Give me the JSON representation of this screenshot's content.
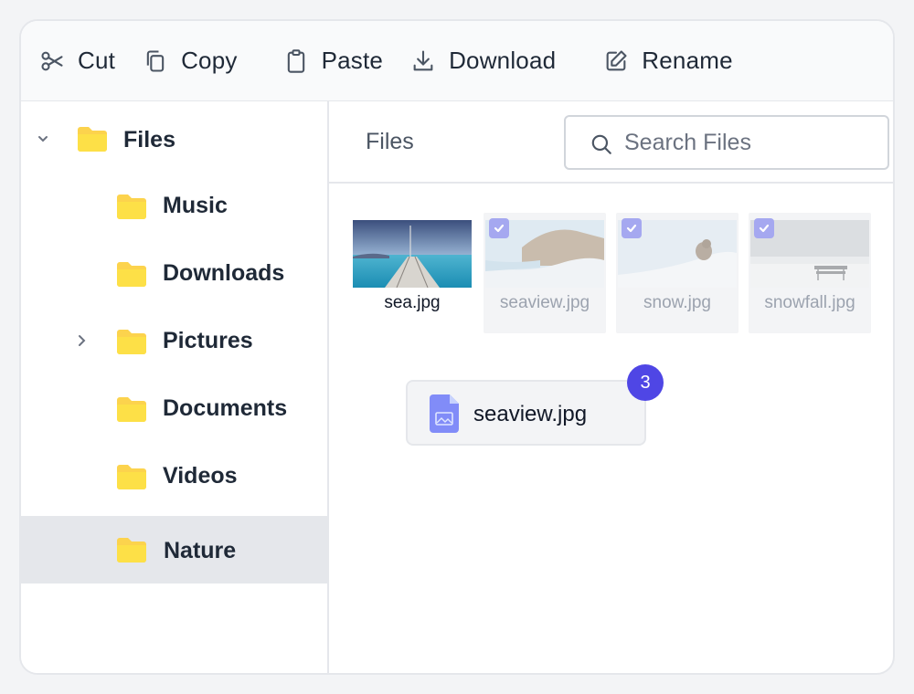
{
  "toolbar": {
    "cut": "Cut",
    "copy": "Copy",
    "paste": "Paste",
    "download": "Download",
    "rename": "Rename"
  },
  "sidebar": {
    "items": [
      {
        "label": "Files",
        "icon": "folder-icon",
        "expanded": true
      },
      {
        "label": "Music",
        "icon": "folder-icon"
      },
      {
        "label": "Downloads",
        "icon": "folder-icon"
      },
      {
        "label": "Pictures",
        "icon": "folder-icon",
        "expanded": false
      },
      {
        "label": "Documents",
        "icon": "folder-icon"
      },
      {
        "label": "Videos",
        "icon": "folder-icon"
      },
      {
        "label": "Nature",
        "icon": "folder-icon",
        "selected": true
      }
    ]
  },
  "main": {
    "breadcrumb": "Files",
    "search_placeholder": "Search Files",
    "files": [
      {
        "name": "sea.jpg",
        "selected": false
      },
      {
        "name": "seaview.jpg",
        "selected": true
      },
      {
        "name": "snow.jpg",
        "selected": true
      },
      {
        "name": "snowfall.jpg",
        "selected": true
      }
    ],
    "drag": {
      "name": "seaview.jpg",
      "count": "3"
    }
  },
  "colors": {
    "accent": "#4f46e5",
    "checkbox": "#a5a8f0",
    "folder": "#fcd34d",
    "selected_bg": "#e5e7eb"
  }
}
